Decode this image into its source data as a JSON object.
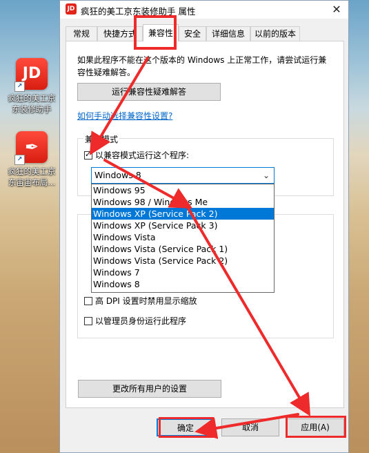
{
  "desktop": {
    "icons": [
      {
        "tile_text": "JD",
        "label": "疯狂的美工京\n东装修助手"
      },
      {
        "tile_text": "✒",
        "label": "疯狂的美工京\n东宙宙布局..."
      }
    ]
  },
  "dialog": {
    "title": "疯狂的美工京东装修助手 属性",
    "title_icon": "JD",
    "close_label": "✕",
    "tabs": [
      "常规",
      "快捷方式",
      "兼容性",
      "安全",
      "详细信息",
      "以前的版本"
    ],
    "active_tab": "兼容性",
    "intro": "如果此程序不能在这个版本的 Windows 上正常工作，请尝试运行兼容性疑难解答。",
    "troubleshoot_button": "运行兼容性疑难解答",
    "manual_link": "如何手动选择兼容性设置?",
    "compat_group": {
      "title": "兼容模式",
      "checkbox_label": "以兼容模式运行这个程序:",
      "checked": true,
      "selected_value": "Windows 8",
      "options": [
        "Windows 95",
        "Windows 98 / Windows Me",
        "Windows XP (Service Pack 2)",
        "Windows XP (Service Pack 3)",
        "Windows Vista",
        "Windows Vista (Service Pack 1)",
        "Windows Vista (Service Pack 2)",
        "Windows 7",
        "Windows 8"
      ],
      "highlighted_option": "Windows XP (Service Pack 2)"
    },
    "settings_group": {
      "dpi_label": "高 DPI 设置时禁用显示缩放",
      "admin_label": "以管理员身份运行此程序"
    },
    "change_all_button": "更改所有用户的设置",
    "ok_button": "确定",
    "cancel_button": "取消",
    "apply_button": "应用(A)"
  },
  "colors": {
    "annotation": "#ee2a2a",
    "accent": "#0078d7"
  }
}
